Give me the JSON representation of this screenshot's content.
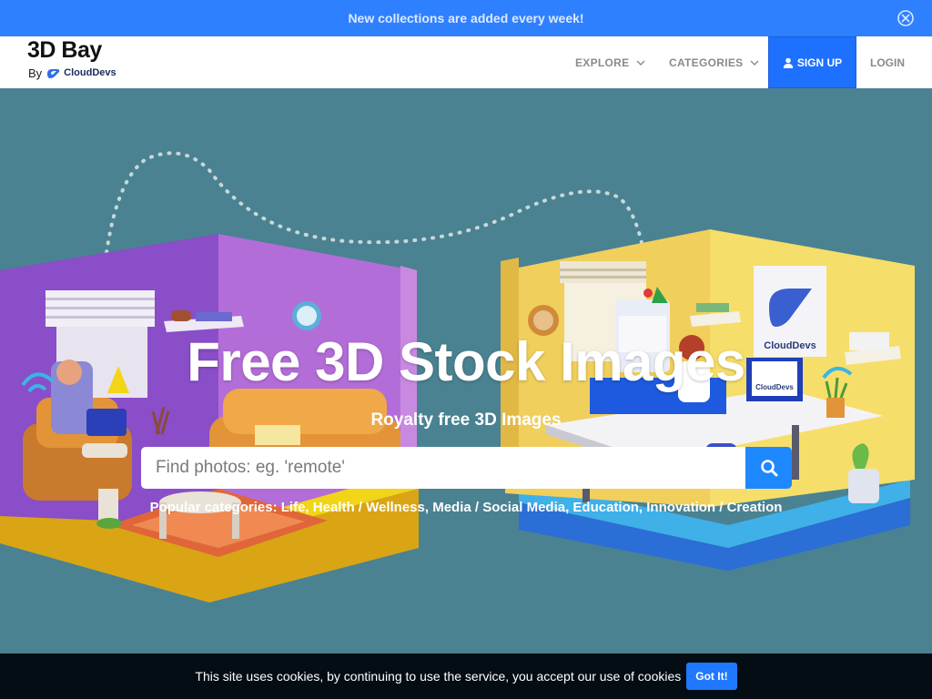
{
  "announcement": {
    "text": "New collections are added every week!"
  },
  "brand": {
    "title": "3D Bay",
    "by": "By",
    "company": "CloudDevs"
  },
  "nav": {
    "explore": "EXPLORE",
    "categories": "CATEGORIES",
    "signup": "SIGN UP",
    "login": "LOGIN"
  },
  "hero": {
    "title": "Free 3D Stock Images",
    "subtitle": "Royalty free 3D Images",
    "search_placeholder": "Find photos: eg. 'remote'",
    "popular": "Popular categories: Life, Health / Wellness, Media / Social Media, Education, Innovation / Creation",
    "poster_text": "CloudDevs",
    "monitor_text": "CloudDevs"
  },
  "cookie": {
    "text": "This site uses cookies, by continuing to use the service, you accept our use of cookies",
    "button": "Got It!"
  },
  "colors": {
    "announce_bg": "#2f80ff",
    "signup_bg": "#1e70ff",
    "hero_bg": "#4a8292",
    "search_button": "#1e88ff",
    "cookie_bg": "#050d14",
    "cookie_button": "#1f78ff"
  },
  "icons": [
    "close-circle-icon",
    "cloud-logo-icon",
    "chevron-down-icon",
    "user-icon",
    "search-icon"
  ]
}
